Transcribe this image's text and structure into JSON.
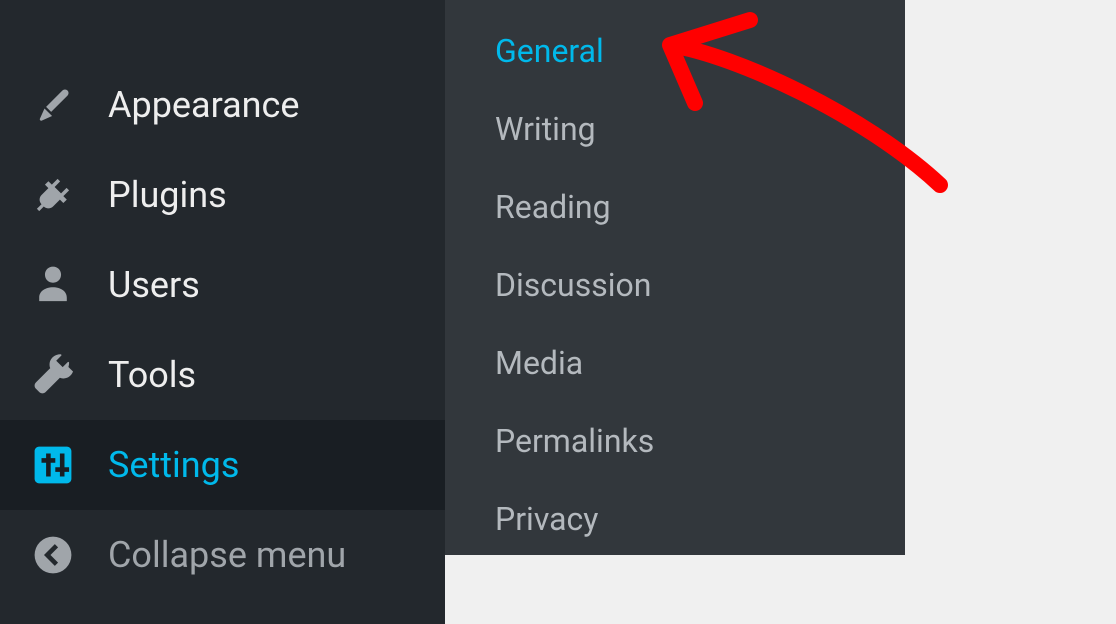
{
  "sidebar": {
    "items": [
      {
        "label": "Appearance",
        "icon": "brush"
      },
      {
        "label": "Plugins",
        "icon": "plug"
      },
      {
        "label": "Users",
        "icon": "user"
      },
      {
        "label": "Tools",
        "icon": "wrench"
      },
      {
        "label": "Settings",
        "icon": "sliders",
        "active": true
      }
    ],
    "collapse": {
      "label": "Collapse menu"
    }
  },
  "submenu": {
    "items": [
      {
        "label": "General",
        "active": true
      },
      {
        "label": "Writing"
      },
      {
        "label": "Reading"
      },
      {
        "label": "Discussion"
      },
      {
        "label": "Media"
      },
      {
        "label": "Permalinks"
      },
      {
        "label": "Privacy"
      }
    ]
  }
}
